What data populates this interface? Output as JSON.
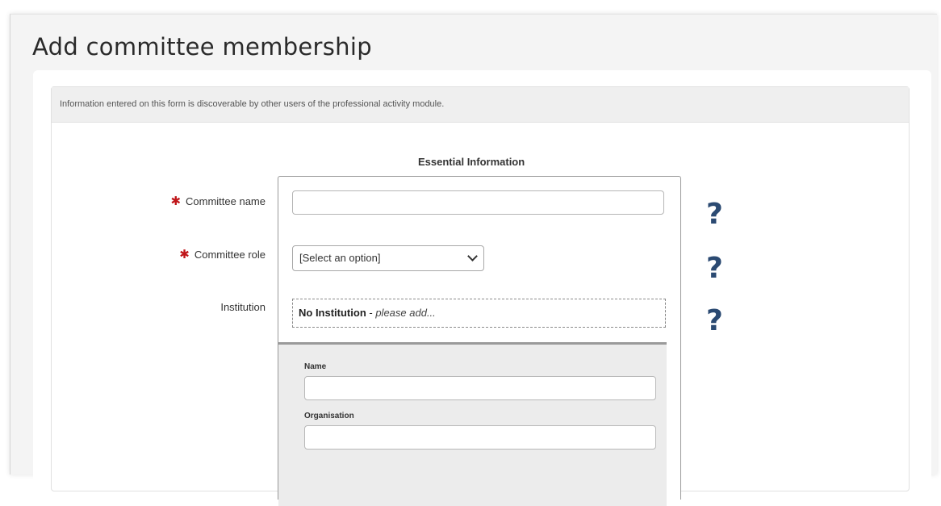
{
  "page": {
    "title": "Add committee membership"
  },
  "notice": {
    "text": "Information entered on this form is discoverable by other users of the professional activity module."
  },
  "form": {
    "section_title": "Essential Information",
    "required_marker": "✱",
    "committee_name": {
      "label": "Committee name",
      "value": "",
      "placeholder": ""
    },
    "committee_role": {
      "label": "Committee role",
      "selected": "[Select an option]"
    },
    "institution": {
      "label": "Institution",
      "value_strong": "No Institution",
      "value_separator": " - ",
      "value_hint": "please add..."
    },
    "institution_details": {
      "name_label": "Name",
      "organisation_label": "Organisation"
    },
    "help_glyph": "?"
  },
  "colors": {
    "required": "#c0161a",
    "help_icon": "#2b4a72"
  }
}
